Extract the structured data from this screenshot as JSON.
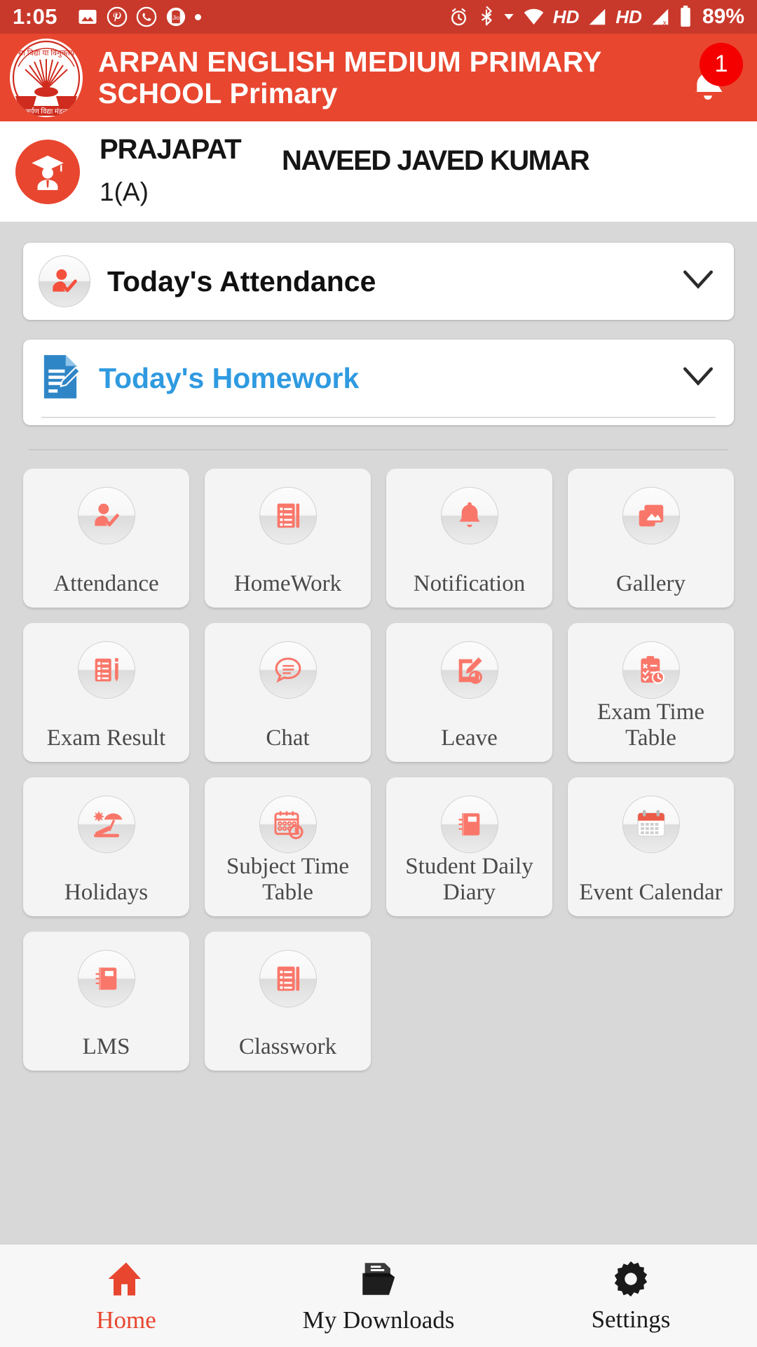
{
  "status_bar": {
    "time": "1:05",
    "battery": "89%",
    "network_label_1": "HD",
    "network_label_2": "HD",
    "icons": [
      "gallery-icon",
      "pinterest-icon",
      "whatsapp-icon",
      "jio-icon",
      "dot-icon",
      "alarm-icon",
      "bluetooth-icon",
      "wifi-icon",
      "signal-icon",
      "signal-off-icon",
      "battery-icon"
    ]
  },
  "app_bar": {
    "title": "ARPAN ENGLISH MEDIUM PRIMARY SCHOOL Primary",
    "logo_name": "school-logo",
    "notification_count": "1"
  },
  "student": {
    "name_line_1": "PRAJAPAT",
    "name_line_2": "NAVEED JAVED KUMAR",
    "class": "1(A)"
  },
  "cards": [
    {
      "label": "Today's Attendance",
      "icon": "attendance-person-check-icon",
      "color": "#101010",
      "expanded": false
    },
    {
      "label": "Today's Homework",
      "icon": "homework-document-pencil-icon",
      "color": "#2f9ae0",
      "expanded": false
    }
  ],
  "grid": [
    {
      "label": "Attendance",
      "icon": "attendance-person-check-icon"
    },
    {
      "label": "HomeWork",
      "icon": "notebook-list-icon"
    },
    {
      "label": "Notification",
      "icon": "bell-icon"
    },
    {
      "label": "Gallery",
      "icon": "photo-stack-icon"
    },
    {
      "label": "Exam Result",
      "icon": "result-sheet-pencil-icon"
    },
    {
      "label": "Chat",
      "icon": "chat-bubble-icon"
    },
    {
      "label": "Leave",
      "icon": "leave-edit-clock-icon"
    },
    {
      "label": "Exam Time Table",
      "icon": "clipboard-clock-icon"
    },
    {
      "label": "Holidays",
      "icon": "beach-umbrella-icon"
    },
    {
      "label": "Subject Time Table",
      "icon": "calendar-clock-icon"
    },
    {
      "label": "Student Daily Diary",
      "icon": "diary-book-icon"
    },
    {
      "label": "Event Calendar",
      "icon": "calendar-icon"
    },
    {
      "label": "LMS",
      "icon": "diary-book-icon"
    },
    {
      "label": "Classwork",
      "icon": "notebook-list-icon"
    }
  ],
  "bottom_nav": [
    {
      "label": "Home",
      "icon": "home-icon",
      "active": true
    },
    {
      "label": "My Downloads",
      "icon": "folder-icon",
      "active": false
    },
    {
      "label": "Settings",
      "icon": "gear-icon",
      "active": false
    }
  ],
  "colors": {
    "status_bar": "#c8392b",
    "app_bar": "#e8462f",
    "accent": "#e8462f",
    "tile_icon": "#f9776a",
    "homework_blue": "#2f9ae0",
    "badge_red": "#f40000",
    "page_bg": "#d8d8d8"
  }
}
